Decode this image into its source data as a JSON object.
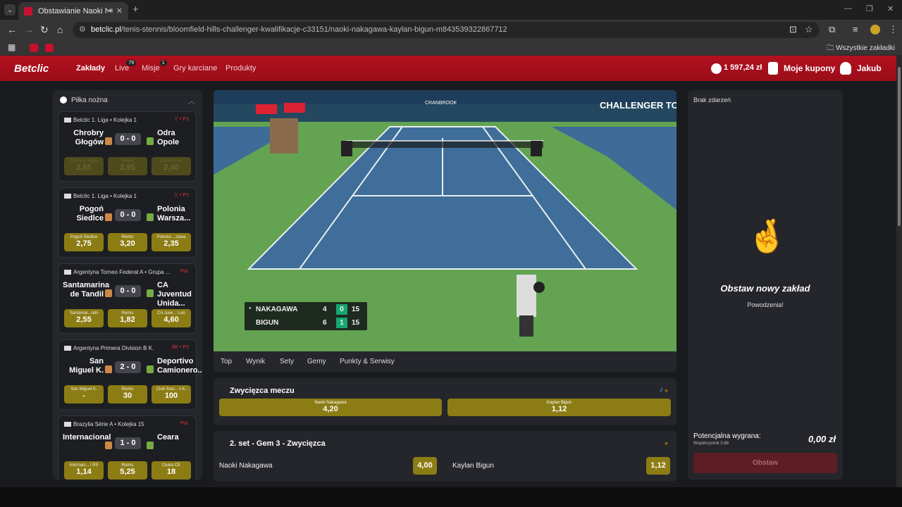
{
  "browser": {
    "tab_title": "Obstawianie Naoki Nakagawa",
    "tab_close": "✕",
    "new_tab": "+",
    "url_host": "betclic.pl",
    "url_path": "/tenis-stennis/bloomfield-hills-challenger-kwalifikacje-c33151/naoki-nakagawa-kaylan-bigun-m843539322867712",
    "bookmarks_all": "Wszystkie zakładki"
  },
  "header": {
    "logo": "Betclic",
    "nav": [
      {
        "label": "Zakłady",
        "badge": ""
      },
      {
        "label": "Live",
        "badge": "79"
      },
      {
        "label": "Misje",
        "badge": "1"
      },
      {
        "label": "Gry karciane",
        "badge": ""
      },
      {
        "label": "Produkty",
        "badge": ""
      }
    ],
    "balance": "1 597,24 zł",
    "coupons": "Moje kupony",
    "coupon_badge": "1",
    "user": "Jakub"
  },
  "sidebar": {
    "title": "Piłka nożna",
    "matches": [
      {
        "league": "Betclic 1. Liga • Kolejka 1",
        "minute": "1' • P1",
        "home": "Chrobry Głogów",
        "away": "Odra Opole",
        "score": "0 - 0",
        "disabled": true,
        "odds": [
          {
            "label": "Chrobry...ogów",
            "value": "2,65"
          },
          {
            "label": "Remis",
            "value": "2,95"
          },
          {
            "label": "Odra Opole",
            "value": "2,40"
          }
        ]
      },
      {
        "league": "Betclic 1. Liga • Kolejka 1",
        "minute": "1' • P1",
        "home": "Pogoń Siedlce",
        "away": "Polonia Warsza...",
        "score": "0 - 0",
        "disabled": false,
        "odds": [
          {
            "label": "Pogoń Siedlce",
            "value": "2,75"
          },
          {
            "label": "Remis",
            "value": "3,20"
          },
          {
            "label": "Polonia ...zawa",
            "value": "2,35"
          }
        ]
      },
      {
        "league": "Argentyna Torneo Federal A • Grupa ...",
        "minute": "Pol.",
        "home": "Santamarina de Tandil",
        "away": "CA Juventud Unida...",
        "score": "0 - 0",
        "disabled": false,
        "odds": [
          {
            "label": "Santamar...ndil",
            "value": "2,55"
          },
          {
            "label": "Remis",
            "value": "1,82"
          },
          {
            "label": "CA Juve... Luis",
            "value": "4,60"
          }
        ]
      },
      {
        "league": "Argentyna Primera Division B K.",
        "minute": "86' • P2",
        "home": "San Miguel K.",
        "away": "Deportivo Camionero...",
        "score": "2 - 0",
        "disabled": false,
        "odds": [
          {
            "label": "San Miguel K.",
            "value": "-"
          },
          {
            "label": "Remis",
            "value": "30"
          },
          {
            "label": "Club Soci... s K.",
            "value": "100"
          }
        ]
      },
      {
        "league": "Brazylia Série A • Kolejka 15",
        "minute": "Pol.",
        "home": "Internacional",
        "away": "Ceara",
        "score": "1 - 0",
        "disabled": false,
        "odds": [
          {
            "label": "Internaci... l RS",
            "value": "1,14"
          },
          {
            "label": "Remis",
            "value": "5,25"
          },
          {
            "label": "Ceara CE",
            "value": "18"
          }
        ]
      }
    ]
  },
  "video": {
    "sponsor": "CRANBROOK",
    "tour": "CHALLENGER TOUR",
    "scoreboard": [
      {
        "player": "NAKAGAWA",
        "set1": "4",
        "set2": "0",
        "points": "15",
        "serving": true
      },
      {
        "player": "BIGUN",
        "set1": "6",
        "set2": "1",
        "points": "15",
        "serving": false
      }
    ]
  },
  "market_tabs": [
    "Top",
    "Wynik",
    "Sety",
    "Gemy",
    "Punkty & Serwisy"
  ],
  "markets": {
    "winner": {
      "title": "Zwycięzca meczu",
      "odds": [
        {
          "label": "Naoki Nakagawa",
          "value": "4,20"
        },
        {
          "label": "Kaylan Bigun",
          "value": "1,12"
        }
      ]
    },
    "game": {
      "title": "2. set - Gem 3 - Zwycięzca",
      "odds": [
        {
          "label": "Naoki Nakagawa",
          "value": "4,00"
        },
        {
          "label": "Kaylan Bigun",
          "value": "1,12"
        }
      ]
    }
  },
  "betslip": {
    "title": "Brak zdarzeń",
    "emoji": "🤞",
    "headline": "Obstaw nowy zakład",
    "sub": "Powodzenia!",
    "potential": "Potencjalna wygrana:",
    "coef": "Współczynnik 0.88",
    "amount": "0,00 zł",
    "button": "Obstaw"
  }
}
